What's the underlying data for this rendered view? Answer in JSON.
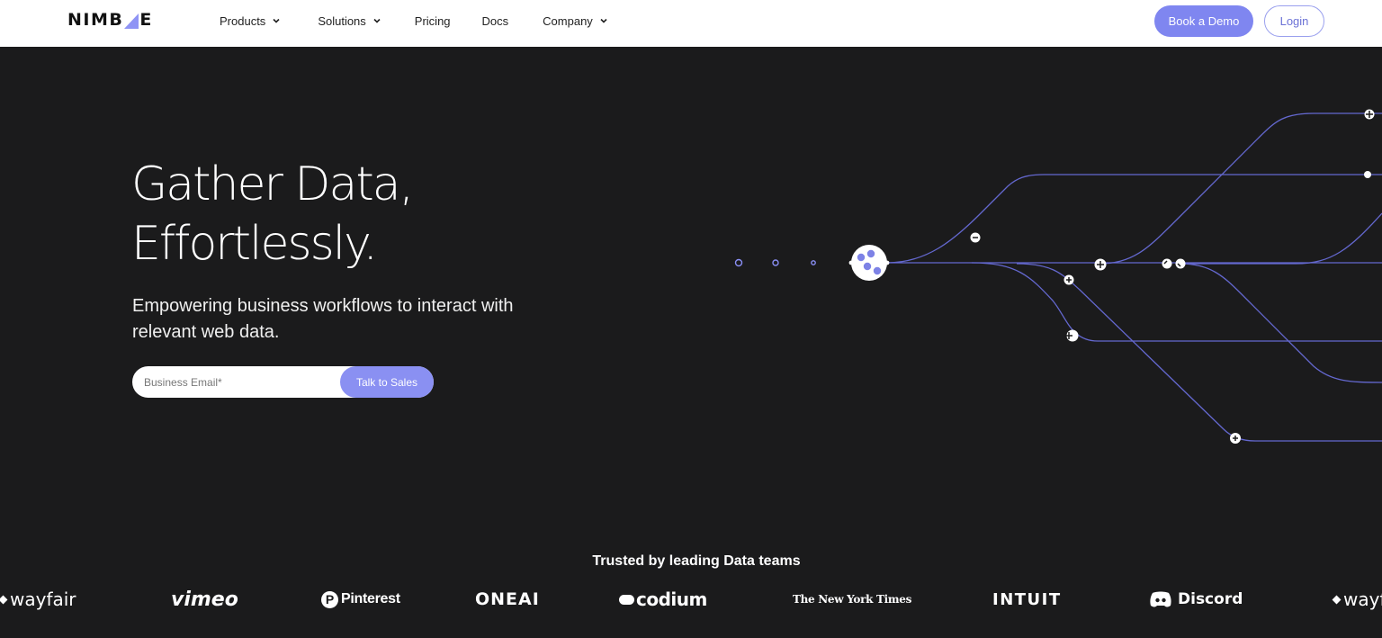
{
  "nav": {
    "logo": "NIMBLE",
    "links": [
      {
        "label": "Products",
        "dropdown": true
      },
      {
        "label": "Solutions",
        "dropdown": true
      },
      {
        "label": "Pricing",
        "dropdown": false
      },
      {
        "label": "Docs",
        "dropdown": false
      },
      {
        "label": "Company",
        "dropdown": true
      }
    ],
    "demo_label": "Book a Demo",
    "login_label": "Login"
  },
  "hero": {
    "title_line1": "Gather Data,",
    "title_line2": "Effortlessly.",
    "subtitle": "Empowering business workflows to interact with relevant web data.",
    "email_placeholder": "Business Email*",
    "cta_label": "Talk to Sales"
  },
  "trusted": {
    "heading": "Trusted by leading Data teams",
    "logos": [
      "wayfair",
      "vimeo",
      "Pinterest",
      "ONEAI",
      "codium",
      "The New York Times",
      "INTUIT",
      "Discord",
      "wayfair"
    ]
  },
  "colors": {
    "background": "#1b1b1c",
    "accent": "#7f86f0",
    "line": "#6b70d8",
    "white": "#ffffff"
  },
  "icons": [
    "chevron-down-icon",
    "hub-node-icon",
    "workflow-node-icon",
    "pinterest-icon",
    "discord-icon"
  ]
}
